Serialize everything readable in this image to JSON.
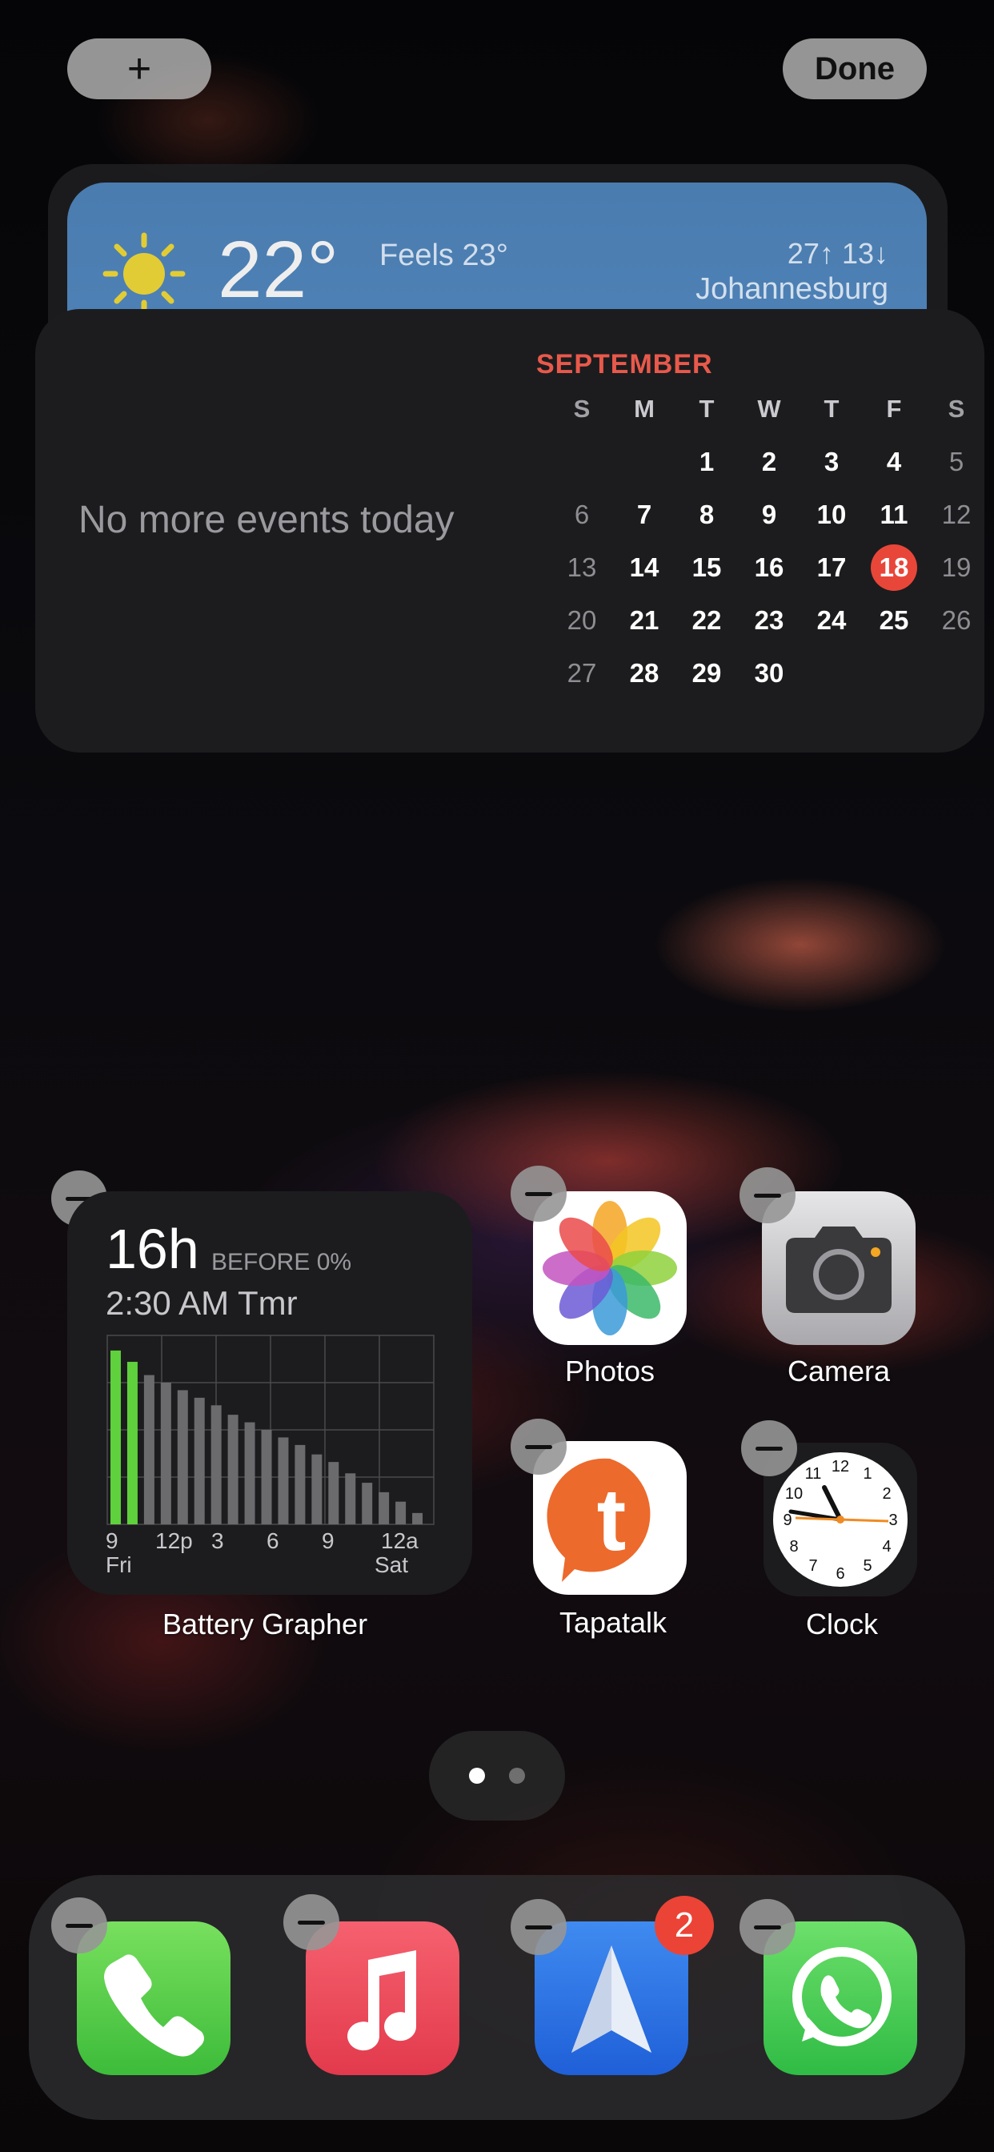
{
  "top_bar": {
    "add_label": "+",
    "done_label": "Done"
  },
  "weather": {
    "temperature": "22°",
    "feels": "Feels 23°",
    "hilo": "27↑ 13↓",
    "city": "Johannesburg"
  },
  "calendar": {
    "no_events": "No more events today",
    "month": "SEPTEMBER",
    "weekdays": [
      "S",
      "M",
      "T",
      "W",
      "T",
      "F",
      "S"
    ],
    "weeks": [
      [
        "",
        "",
        "1",
        "2",
        "3",
        "4",
        "5"
      ],
      [
        "6",
        "7",
        "8",
        "9",
        "10",
        "11",
        "12"
      ],
      [
        "13",
        "14",
        "15",
        "16",
        "17",
        "18",
        "19"
      ],
      [
        "20",
        "21",
        "22",
        "23",
        "24",
        "25",
        "26"
      ],
      [
        "27",
        "28",
        "29",
        "30",
        "",
        "",
        ""
      ]
    ],
    "today": "18"
  },
  "battery_widget": {
    "hours": "16h",
    "before": "BEFORE 0%",
    "time": "2:30 AM Tmr",
    "label": "Battery Grapher",
    "x_labels": [
      "9",
      "12p",
      "3",
      "6",
      "9",
      "12a"
    ],
    "x_sublabels": [
      "Fri",
      "Sat"
    ],
    "bar_levels": [
      0.92,
      0.86,
      0.79,
      0.75,
      0.71,
      0.67,
      0.63,
      0.58,
      0.54,
      0.5,
      0.46,
      0.42,
      0.37,
      0.33,
      0.27,
      0.22,
      0.17,
      0.12,
      0.06
    ],
    "bar_highlight_count": 2,
    "colors": {
      "green": "#5fd13c",
      "gray": "#6b6b6e"
    }
  },
  "apps": {
    "photos": "Photos",
    "camera": "Camera",
    "tapatalk": "Tapatalk",
    "clock": "Clock"
  },
  "dock": {
    "spark_badge": "2"
  }
}
